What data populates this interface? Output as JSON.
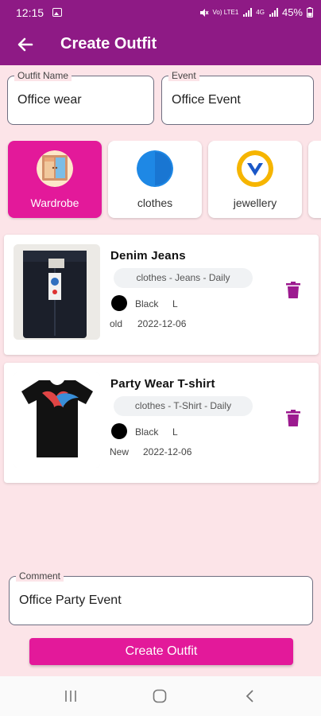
{
  "status_bar": {
    "time": "12:15",
    "net_top": "Vo) LTE1",
    "net_bottom": "4G",
    "battery": "45%"
  },
  "app_bar": {
    "title": "Create Outfit"
  },
  "form": {
    "outfit_name": {
      "label": "Outfit Name",
      "value": "Office wear"
    },
    "event": {
      "label": "Event",
      "value": "Office Event"
    },
    "comment": {
      "label": "Comment",
      "value": "Office Party Event"
    }
  },
  "categories": [
    {
      "label": "Wardrobe",
      "icon": "wardrobe-icon",
      "selected": true
    },
    {
      "label": "clothes",
      "icon": "shirt-icon",
      "selected": false
    },
    {
      "label": "jewellery",
      "icon": "jewellery-icon",
      "selected": false
    }
  ],
  "items": [
    {
      "name": "Denim Jeans",
      "tags": "clothes - Jeans - Daily",
      "color_name": "Black",
      "color": "#000000",
      "size": "L",
      "condition": "old",
      "date": "2022-12-06",
      "image": "jeans-image"
    },
    {
      "name": "Party Wear T-shirt",
      "tags": "clothes - T-Shirt - Daily",
      "color_name": "Black",
      "color": "#000000",
      "size": "L",
      "condition": "New",
      "date": "2022-12-06",
      "image": "tshirt-image"
    }
  ],
  "actions": {
    "create_button": "Create Outfit"
  },
  "colors": {
    "primary": "#8e1a85",
    "accent": "#e3199a",
    "background": "#fce4e8"
  }
}
